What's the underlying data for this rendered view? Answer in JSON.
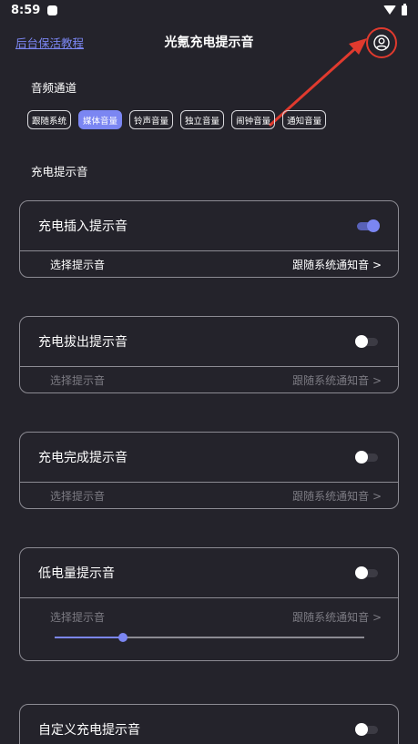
{
  "status_bar": {
    "time": "8:59"
  },
  "header": {
    "tutorial_link": "后台保活教程",
    "title": "光氪充电提示音"
  },
  "audio_channel": {
    "label": "音频通道",
    "options": [
      "跟随系统",
      "媒体音量",
      "铃声音量",
      "独立音量",
      "闹钟音量",
      "通知音量"
    ],
    "selected": "媒体音量"
  },
  "charge_sound_section": {
    "label": "充电提示音"
  },
  "cards": [
    {
      "title": "充电插入提示音",
      "enabled": true,
      "row_label": "选择提示音",
      "row_value": "跟随系统通知音 >"
    },
    {
      "title": "充电拔出提示音",
      "enabled": false,
      "row_label": "选择提示音",
      "row_value": "跟随系统通知音 >"
    },
    {
      "title": "充电完成提示音",
      "enabled": false,
      "row_label": "选择提示音",
      "row_value": "跟随系统通知音 >"
    },
    {
      "title": "低电量提示音",
      "enabled": false,
      "row_label": "选择提示音",
      "row_value": "跟随系统通知音 >",
      "slider_fraction": 0.22
    },
    {
      "title": "自定义充电提示音",
      "enabled": false
    }
  ],
  "colors": {
    "background": "#24232b",
    "accent": "#7b86f2",
    "annotation_red": "#e03a2e"
  }
}
